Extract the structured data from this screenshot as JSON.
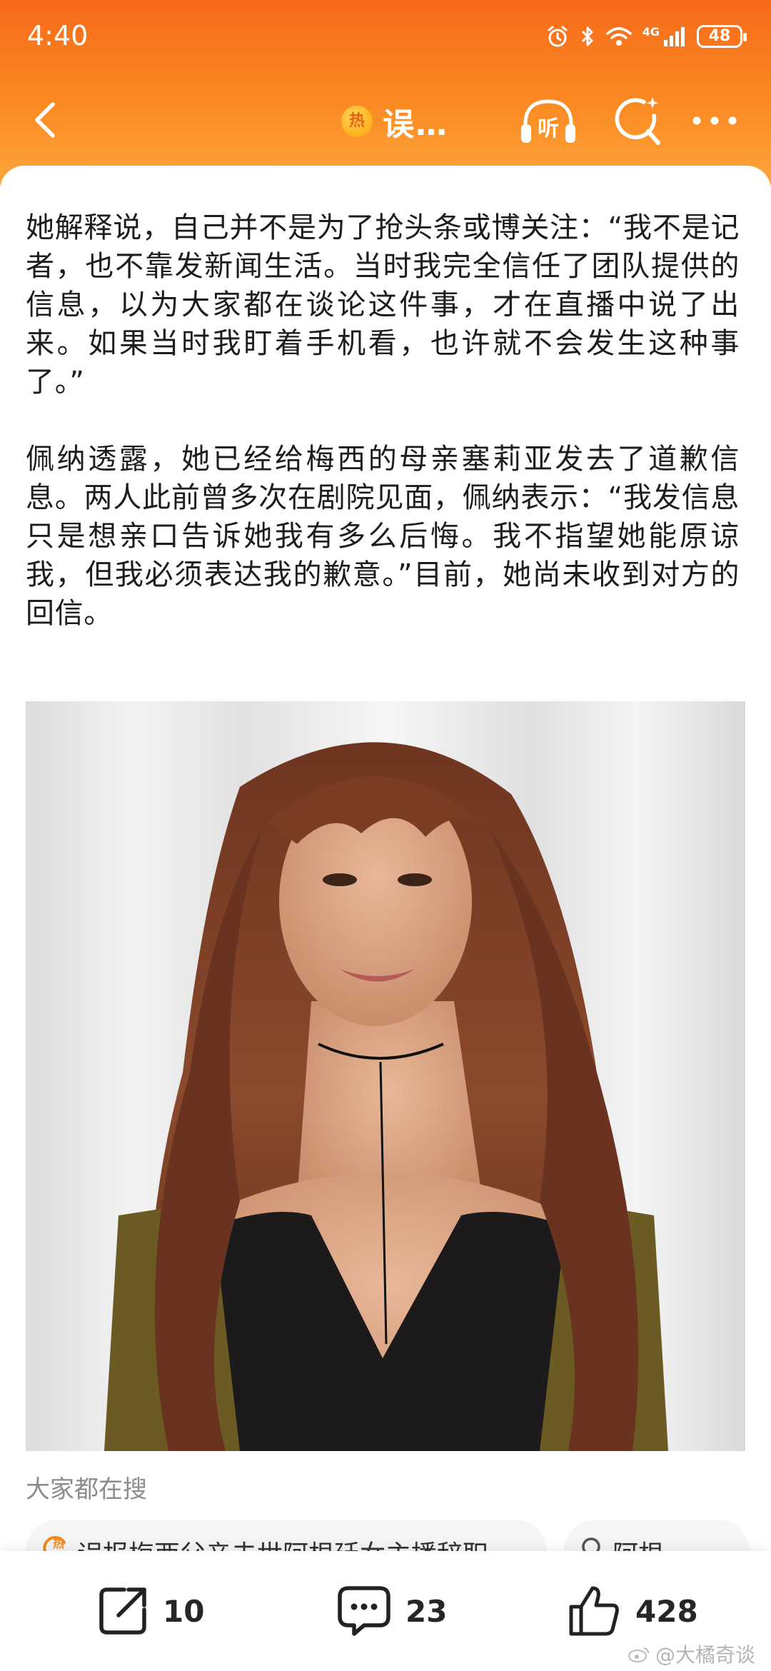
{
  "status_bar": {
    "time": "4:40",
    "network": "4G",
    "battery": "48"
  },
  "nav": {
    "badge": "热",
    "title": "误…",
    "listen_label": "听"
  },
  "article": {
    "paragraphs": [
      "她解释说，自己并不是为了抢头条或博关注：“我不是记者，也不靠发新闻生活。当时我完全信任了团队提供的信息，以为大家都在谈论这件事，才在直播中说了出来。如果当时我盯着手机看，也许就不会发生这种事了。”",
      "佩纳透露，她已经给梅西的母亲塞莉亚发去了道歉信息。两人此前曾多次在剧院见面，佩纳表示：“我发信息只是想亲口告诉她我有多么后悔。我不指望她能原谅我，但我必须表达我的歉意。”目前，她尚未收到对方的回信。"
    ]
  },
  "hot_search": {
    "label": "大家都在搜",
    "items": [
      {
        "badge": "热",
        "text": "误报梅西父亲去世阿根廷女主播辞职"
      },
      {
        "text": "阿根"
      }
    ]
  },
  "actions": {
    "share_count": "10",
    "comment_count": "23",
    "like_count": "428"
  },
  "watermark": "@大橘奇谈",
  "colors": {
    "header_top": "#f76a1b",
    "header_bottom": "#fda53c",
    "badge": "#ffb21c"
  }
}
